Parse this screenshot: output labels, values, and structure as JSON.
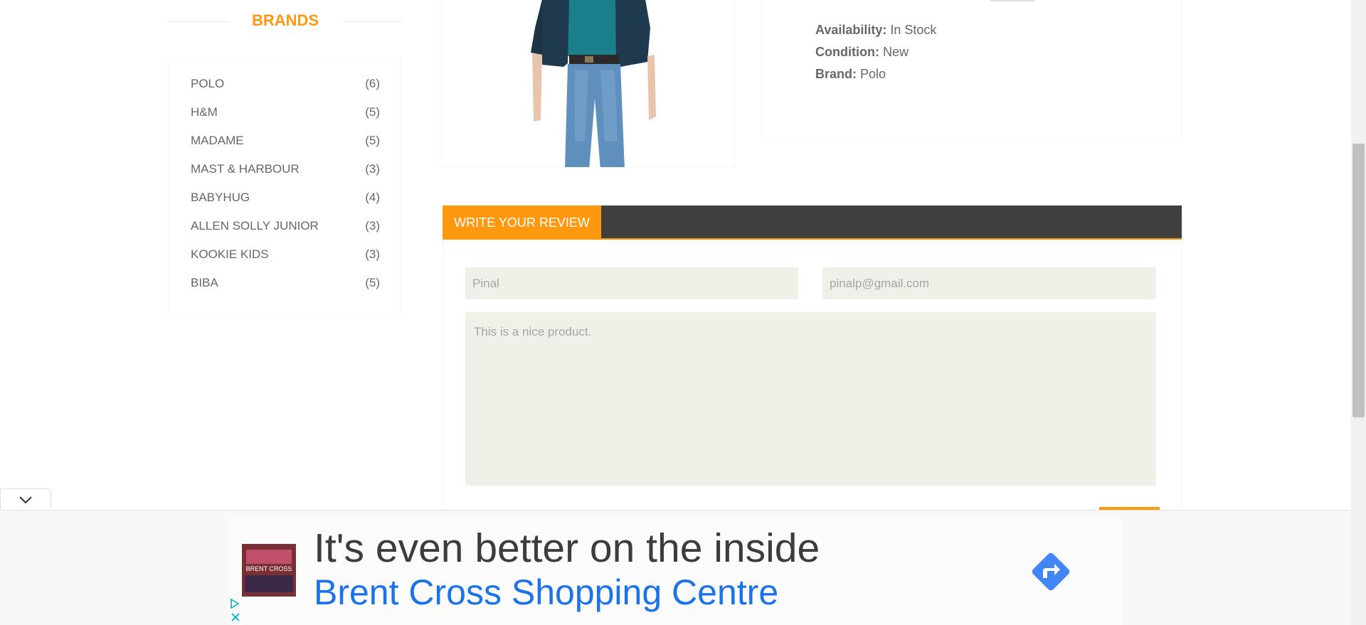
{
  "sidebar": {
    "brands_title": "BRANDS",
    "brands": [
      {
        "name": "POLO",
        "count": "(6)"
      },
      {
        "name": "H&M",
        "count": "(5)"
      },
      {
        "name": "MADAME",
        "count": "(5)"
      },
      {
        "name": "MAST & HARBOUR",
        "count": "(3)"
      },
      {
        "name": "BABYHUG",
        "count": "(4)"
      },
      {
        "name": "ALLEN SOLLY JUNIOR",
        "count": "(3)"
      },
      {
        "name": "KOOKIE KIDS",
        "count": "(3)"
      },
      {
        "name": "BIBA",
        "count": "(5)"
      }
    ]
  },
  "product": {
    "availability_label": "Availability:",
    "availability_value": "In Stock",
    "condition_label": "Condition:",
    "condition_value": "New",
    "brand_label": "Brand:",
    "brand_value": "Polo"
  },
  "review": {
    "tab_label": "WRITE YOUR REVIEW",
    "name_value": "Pinal",
    "email_value": "pinalp@gmail.com",
    "review_value": "This is a nice product."
  },
  "ad": {
    "headline": "It's even better on the inside",
    "advertiser": "Brent Cross Shopping Centre",
    "thumb_text": "BRENT CROSS"
  },
  "colors": {
    "accent": "#fe980f",
    "dark_bar": "#40403e",
    "field_bg": "#f0f0e9",
    "ad_link": "#1a73e8"
  }
}
